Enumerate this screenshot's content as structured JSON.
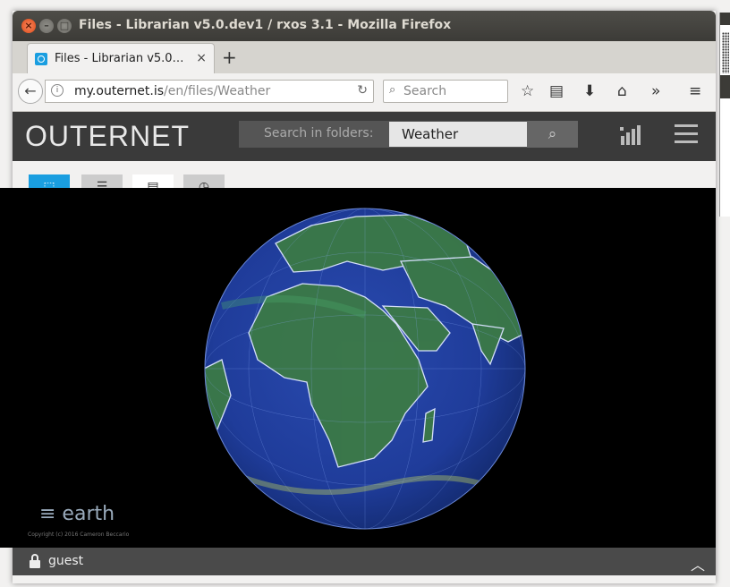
{
  "window": {
    "title": "Files - Librarian v5.0.dev1 / rxos 3.1 - Mozilla Firefox",
    "close_glyph": "×",
    "min_glyph": "–",
    "max_glyph": "□"
  },
  "tabs": [
    {
      "title": "Files - Librarian v5.0…",
      "close": "×"
    }
  ],
  "newtab_label": "+",
  "navbar": {
    "back": "←",
    "url_host": "my.outernet.is",
    "url_path": "/en/files/Weather",
    "search_placeholder": "Search",
    "search_icon": "search-icon",
    "reload": "↻",
    "toolbar_icons": [
      "bookmark-star-icon",
      "reading-list-icon",
      "download-icon",
      "home-icon",
      "overflow-icon",
      "menu-icon"
    ],
    "toolbar_glyphs": [
      "☆",
      "▤",
      "⬇",
      "⌂",
      "»",
      "≡"
    ]
  },
  "site": {
    "logo": "OUTERNET",
    "search_label": "Search in folders:",
    "search_value": "Weather",
    "search_glyph": "⌕",
    "view_tabs": [
      {
        "name": "folders",
        "glyph": "⬚",
        "active": true
      },
      {
        "name": "list",
        "glyph": "☰",
        "active": false
      },
      {
        "name": "reader",
        "glyph": "▤",
        "active": false
      },
      {
        "name": "history",
        "glyph": "◷",
        "active": false
      }
    ]
  },
  "earth": {
    "brand": "≡ earth",
    "copyright": "Copyright (c) 2016 Cameron Beccario"
  },
  "footer": {
    "user": "guest",
    "chevron": "︿"
  },
  "colors": {
    "accent": "#1a9ee0",
    "header": "#3a3a3a",
    "titlebar": "#3c3b37",
    "close_button": "#df4a16"
  }
}
